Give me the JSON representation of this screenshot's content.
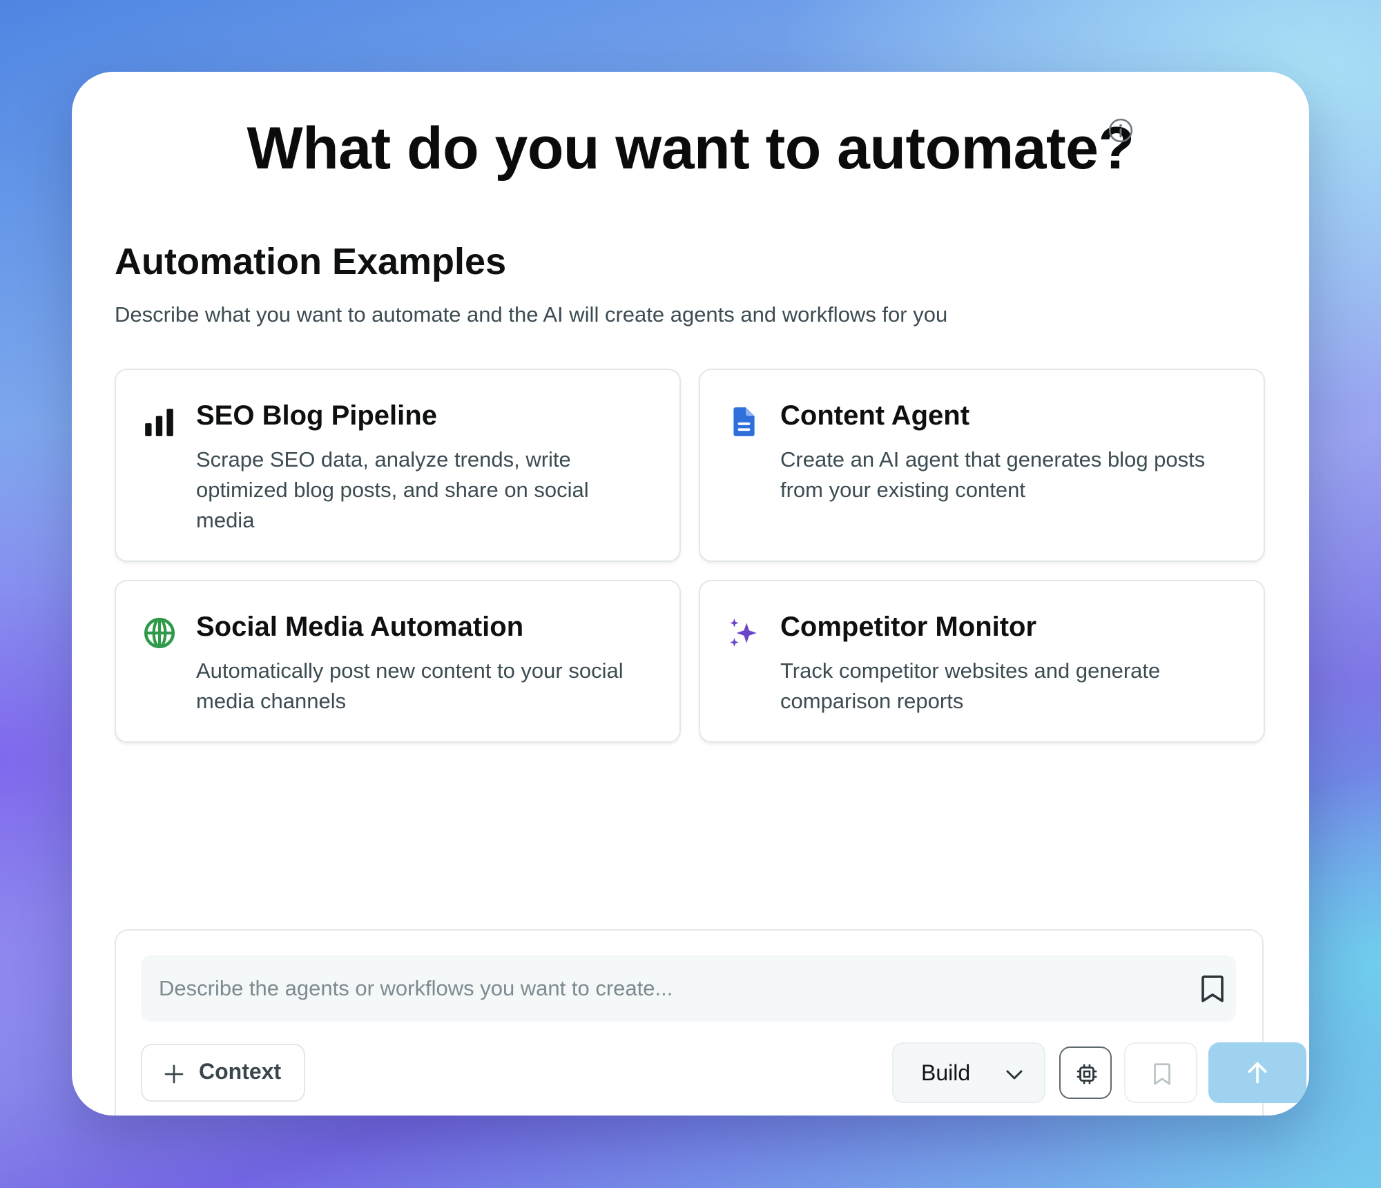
{
  "header": {
    "title": "What do you want to automate?",
    "info_icon": "info-icon"
  },
  "examples": {
    "title": "Automation Examples",
    "description": "Describe what you want to automate and the AI will create agents and workflows for you",
    "cards": [
      {
        "icon": "bar-chart-icon",
        "icon_color": "#0e0f10",
        "title": "SEO Blog Pipeline",
        "description": "Scrape SEO data, analyze trends, write optimized blog posts, and share on social media"
      },
      {
        "icon": "document-icon",
        "icon_color": "#2f6fdc",
        "title": "Content Agent",
        "description": "Create an AI agent that generates blog posts from your existing content"
      },
      {
        "icon": "globe-icon",
        "icon_color": "#2e9a4a",
        "title": "Social Media Automation",
        "description": "Automatically post new content to your social media channels"
      },
      {
        "icon": "sparkles-icon",
        "icon_color": "#6a45c9",
        "title": "Competitor Monitor",
        "description": "Track competitor websites and generate comparison reports"
      }
    ]
  },
  "composer": {
    "placeholder": "Describe the agents or workflows you want to create...",
    "value": "",
    "context_label": "Context",
    "mode_label": "Build",
    "send_color": "#9fd2ef"
  }
}
